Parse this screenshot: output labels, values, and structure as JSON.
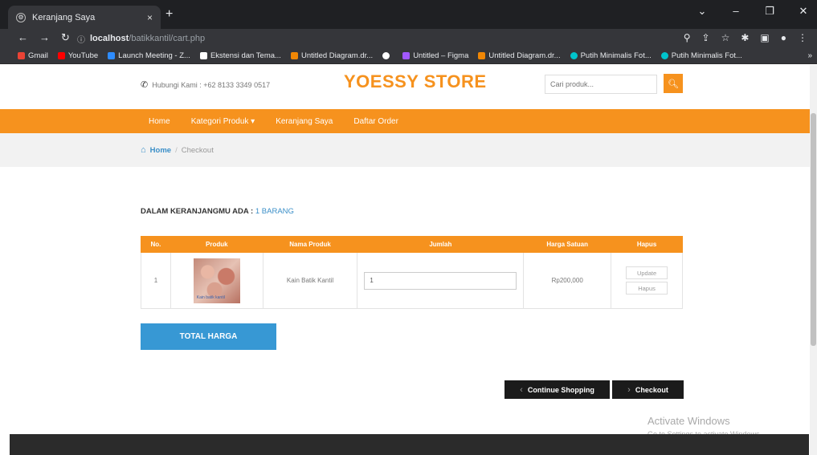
{
  "browser": {
    "tab_title": "Keranjang Saya",
    "tab_close": "×",
    "new_tab": "+",
    "url_host": "localhost",
    "url_path": "/batikkantil/cart.php",
    "bookmarks": [
      {
        "label": "Gmail",
        "color": "#ea4335"
      },
      {
        "label": "YouTube",
        "color": "#ff0000"
      },
      {
        "label": "Launch Meeting - Z...",
        "color": "#2d8cff"
      },
      {
        "label": "Ekstensi dan Tema...",
        "color": "#ffffff"
      },
      {
        "label": "Untitled Diagram.dr...",
        "color": "#f08705"
      },
      {
        "label": "",
        "color": "#ffffff"
      },
      {
        "label": "Untitled – Figma",
        "color": "#a259ff"
      },
      {
        "label": "Untitled Diagram.dr...",
        "color": "#f08705"
      },
      {
        "label": "Putih Minimalis Fot...",
        "color": "#00c4cc"
      },
      {
        "label": "Putih Minimalis Fot...",
        "color": "#00c4cc"
      }
    ],
    "bookmarks_more": "»"
  },
  "header": {
    "contact": "Hubungi Kami : +62 8133 3349 0517",
    "brand": "YOESSY STORE",
    "search_placeholder": "Cari produk..."
  },
  "nav": {
    "items": [
      "Home",
      "Kategori Produk ▾",
      "Keranjang Saya",
      "Daftar Order"
    ]
  },
  "breadcrumb": {
    "home": "Home",
    "separator": "/",
    "current": "Checkout"
  },
  "cart": {
    "count_label": "DALAM KERANJANGMU ADA :",
    "count_value": "1 BARANG",
    "columns": [
      "No.",
      "Produk",
      "Nama Produk",
      "Jumlah",
      "Harga Satuan",
      "Hapus"
    ],
    "rows": [
      {
        "no": "1",
        "image_caption": "Kain batik kantil",
        "name": "Kain Batik Kantil",
        "qty": "1",
        "price": "Rp200,000",
        "update_label": "Update",
        "delete_label": "Hapus"
      }
    ],
    "total_label": "TOTAL HARGA"
  },
  "actions": {
    "continue_label": "Continue Shopping",
    "checkout_label": "Checkout"
  },
  "watermark": {
    "title": "Activate Windows",
    "subtitle": "Go to Settings to activate Windows."
  },
  "colors": {
    "accent": "#f6921e",
    "link": "#3b8fc8",
    "total_button": "#3798d4",
    "dark_button": "#1b1b1b"
  }
}
